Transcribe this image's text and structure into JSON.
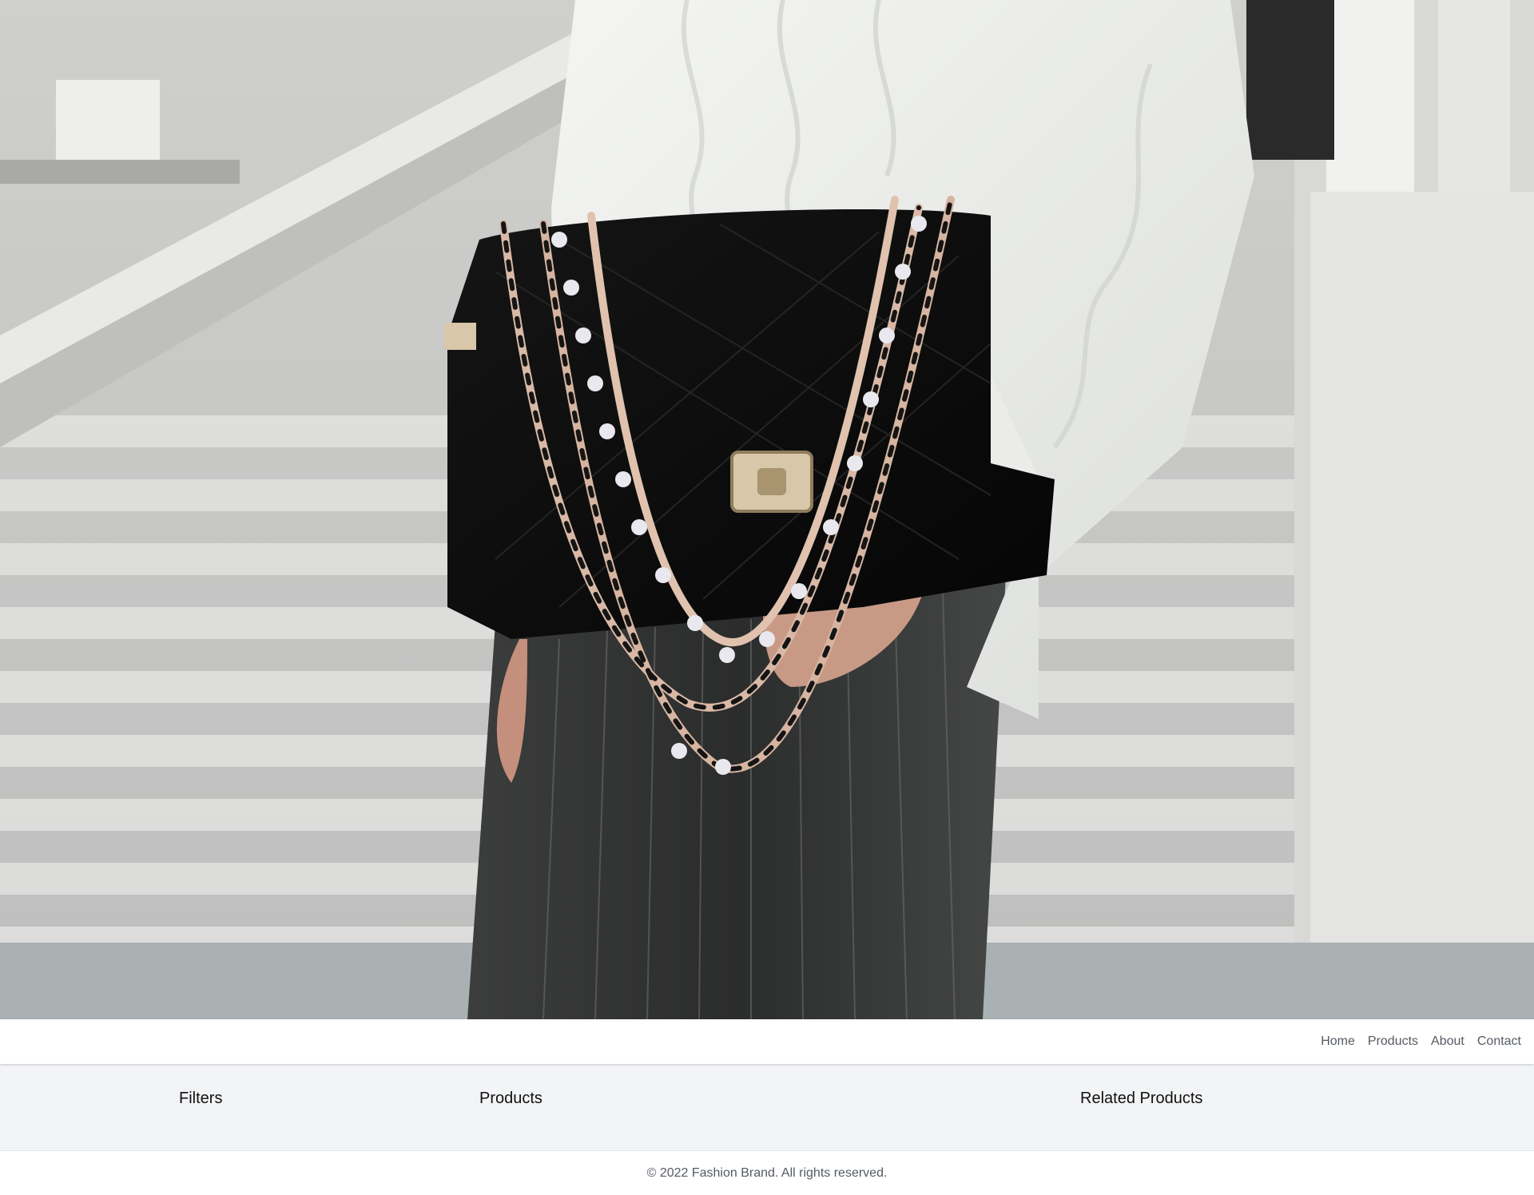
{
  "hero": {
    "image_description_icon": "hero-photo"
  },
  "nav": {
    "links": [
      "Home",
      "Products",
      "About",
      "Contact"
    ]
  },
  "main": {
    "filters_heading": "Filters",
    "products_heading": "Products",
    "related_heading": "Related Products"
  },
  "footer": {
    "copyright": "© 2022 Fashion Brand. All rights reserved."
  },
  "colors": {
    "nav_text": "#555a63",
    "main_bg": "#f3f4f6",
    "heading_text": "#111111"
  }
}
